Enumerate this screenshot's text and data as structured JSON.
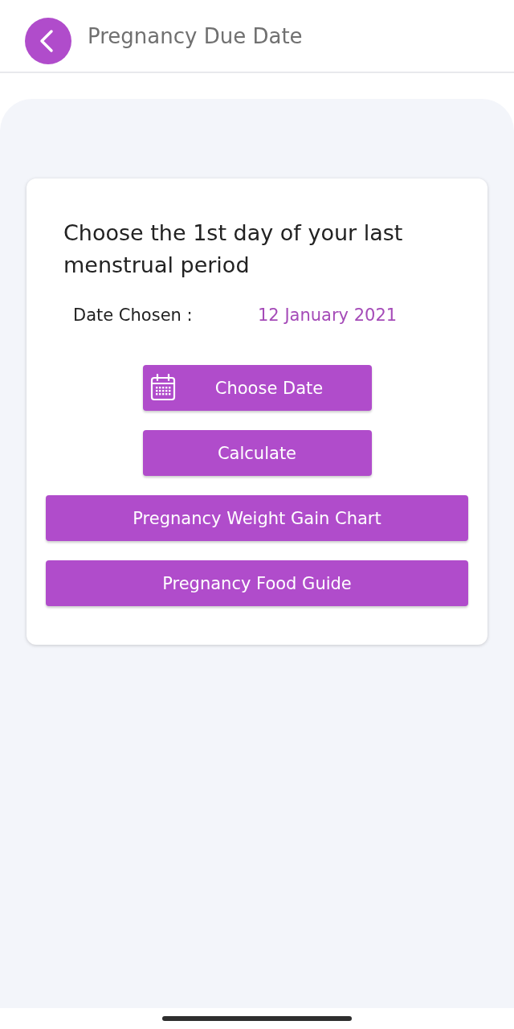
{
  "header": {
    "title": "Pregnancy Due Date"
  },
  "card": {
    "heading": "Choose the 1st day of your last menstrual period",
    "date_label": "Date Chosen :",
    "date_value": "12 January 2021"
  },
  "buttons": [
    {
      "label": "Choose Date",
      "kind": "picker"
    },
    {
      "label": "Calculate",
      "kind": "narrow"
    },
    {
      "label": "Pregnancy Weight Gain Chart",
      "kind": "wide"
    },
    {
      "label": "Pregnancy Food Guide",
      "kind": "wide"
    }
  ]
}
